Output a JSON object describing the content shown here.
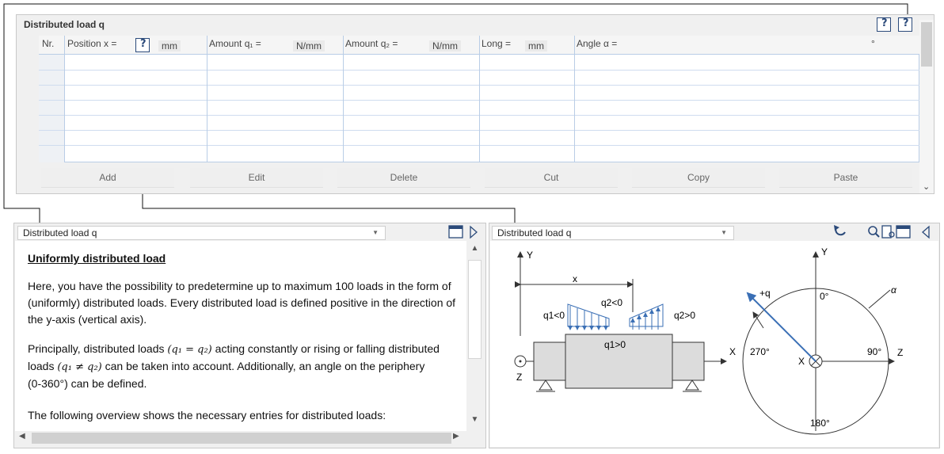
{
  "top": {
    "title": "Distributed load q",
    "columns": [
      {
        "label": "Nr.",
        "unit": ""
      },
      {
        "label": "Position x =",
        "unit": "mm"
      },
      {
        "label": "Amount q₁ =",
        "unit": "N/mm"
      },
      {
        "label": "Amount q₂ =",
        "unit": "N/mm"
      },
      {
        "label": "Long =",
        "unit": "mm"
      },
      {
        "label": "Angle α =",
        "unit": "°"
      }
    ],
    "actions": [
      "Add",
      "Edit",
      "Delete",
      "Cut",
      "Copy",
      "Paste"
    ]
  },
  "help_panel": {
    "selector": "Distributed load q",
    "heading": "Uniformly distributed load",
    "paragraph1": "Here, you have the possibility to predetermine up to maximum 100 loads in the form of (uniformly) distributed loads. Every distributed load is defined positive in the direction of the y-axis (vertical axis).",
    "paragraph2a": "Principally, distributed loads",
    "formula1": "(q₁ = q₂)",
    "paragraph2b": "acting constantly or rising or falling distributed",
    "paragraph2c": "loads",
    "formula2": "(q₁ ≠ q₂)",
    "paragraph2d": "can be taken into account. Additionally, an angle on the periphery",
    "paragraph2e": "(0-360°) can be defined.",
    "paragraph3": "The following overview shows the necessary entries for distributed loads:"
  },
  "drawing_panel": {
    "selector": "Distributed load q",
    "labels": {
      "y_left": "Y",
      "x_dim": "x",
      "q1_neg": "q1<0",
      "q2_neg": "q2<0",
      "q2_pos": "q2>0",
      "q1_pos": "q1>0",
      "x_axis_left": "X",
      "z_left": "Z",
      "y_right": "Y",
      "plus_q": "+q",
      "deg0": "0°",
      "alpha": "α",
      "deg270": "270°",
      "deg90": "90°",
      "x_center": "X",
      "z_right": "Z",
      "deg180": "180°"
    }
  }
}
